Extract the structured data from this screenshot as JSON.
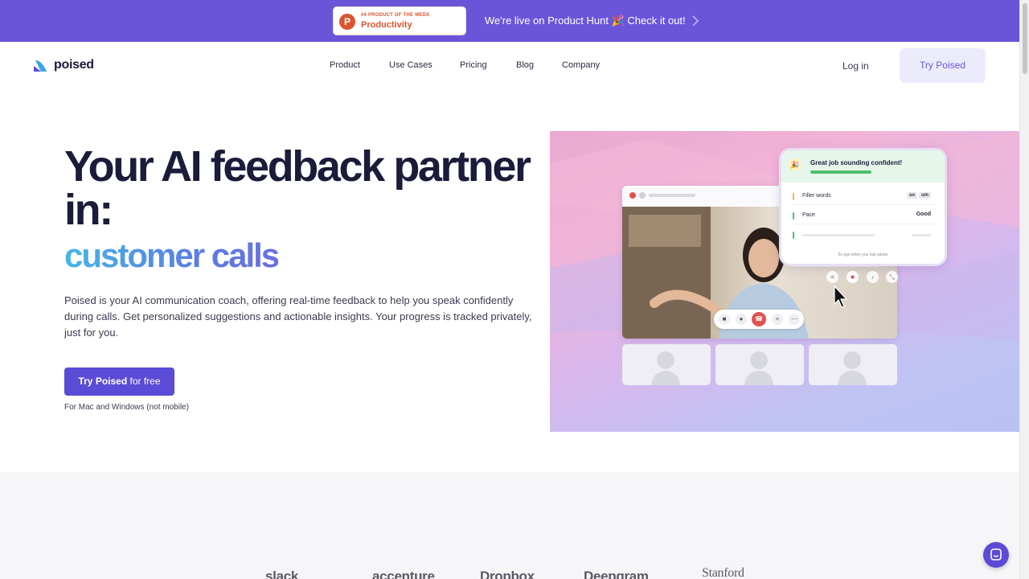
{
  "announcement": {
    "badge_kicker": "#4 PRODUCT OF THE WEEK",
    "badge_category": "Productivity",
    "badge_logo_letter": "P",
    "text": "We're live on Product Hunt 🎉 Check it out!",
    "chevron_icon": "chevron-right-icon",
    "colors": {
      "bar": "#6a55d9",
      "product_hunt": "#da552f"
    }
  },
  "header": {
    "brand": "poised",
    "nav": [
      "Product",
      "Use Cases",
      "Pricing",
      "Blog",
      "Company"
    ],
    "login": "Log in",
    "cta": "Try Poised"
  },
  "hero": {
    "title": "Your AI feedback partner in:",
    "accent": "customer calls",
    "description": "Poised is your AI communication coach, offering real-time feedback to help you speak confidently during calls. Get personalized suggestions and actionable insights. Your progress is tracked privately, just for you.",
    "cta_bold": "Try Poised",
    "cta_rest": " for free",
    "note": "For Mac and Windows (not mobile)"
  },
  "mockup": {
    "feedback_title": "Great job sounding confident!",
    "rows": [
      {
        "label": "Filler words",
        "chips": [
          "so",
          "um"
        ]
      },
      {
        "label": "Pace",
        "value": "Good"
      }
    ],
    "footer": "5s ago when you last spoke",
    "call_controls": [
      "camera-icon",
      "mic-icon",
      "end-call-icon",
      "add-person-icon",
      "more-icon"
    ],
    "mini_controls": [
      "bars-icon",
      "record-icon",
      "bell-icon",
      "collapse-icon"
    ]
  },
  "logos": [
    "slack",
    "accenture",
    "Dropbox",
    "Deepgram",
    "Stanford"
  ],
  "chat": {
    "icon": "chat-icon"
  }
}
